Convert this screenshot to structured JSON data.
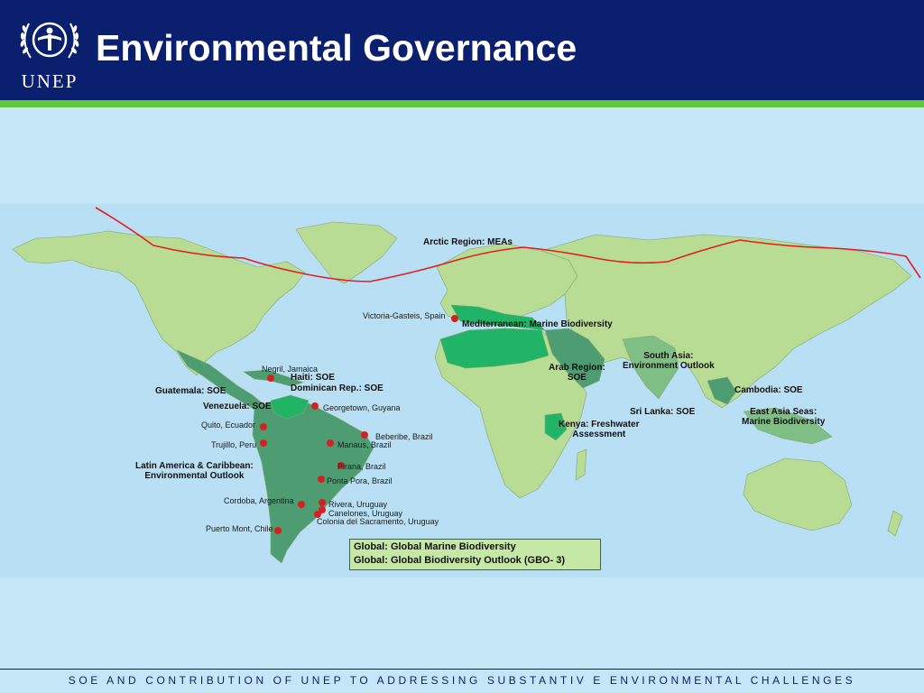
{
  "header": {
    "title": "Environmental Governance",
    "logo_text": "UNEP",
    "bg_color": "#0a1f6e",
    "accent_color": "#5ec83a"
  },
  "map": {
    "arctic_label": "Arctic Region: MEAs",
    "region_labels": {
      "mediterranean": "Mediterranean: Marine Biodiversity",
      "arab_region": [
        "Arab Region:",
        "SOE"
      ],
      "south_asia": [
        "South Asia:",
        "Environment Outlook"
      ],
      "cambodia": "Cambodia: SOE",
      "sri_lanka": "Sri Lanka: SOE",
      "east_asia_seas": [
        "East Asia Seas:",
        "Marine Biodiversity"
      ],
      "kenya": [
        "Kenya: Freshwater",
        "Assessment"
      ],
      "haiti": "Haiti: SOE",
      "dominican_rep": "Dominican Rep.: SOE",
      "guatemala": "Guatemala: SOE",
      "venezuela": "Venezuela: SOE",
      "latin_america": [
        "Latin America & Caribbean:",
        "Environmental Outlook"
      ]
    },
    "city_labels": {
      "victoria_gasteis": "Victoria-Gasteis, Spain",
      "negril": "Negril, Jamaica",
      "georgetown": "Georgetown, Guyana",
      "quito": "Quito, Ecuador",
      "trujillo": "Trujillo, Peru",
      "beberibe": "Beberibe, Brazil",
      "manaus": "Manaus, Brazil",
      "pirana": "Pirana, Brazil",
      "ponta_pora": "Ponta Pora, Brazil",
      "cordoba": "Cordoba, Argentina",
      "rivera": "Rivera, Uruguay",
      "canelones": "Canelones,  Uruguay",
      "colonia": "Colonia del Sacramento, Uruguay",
      "puerto_montt": "Puerto Mont, Chile"
    },
    "legend": {
      "line1": "Global: Global Marine Biodiversity",
      "line2": "Global: Global Biodiversity Outlook (GBO- 3)"
    },
    "colors": {
      "ocean": "#b8dff3",
      "land": "#b9dc94",
      "highlight_dark": "#4e9c72",
      "highlight_bright": "#22b466",
      "marker": "#d42020",
      "arctic_line": "#e02020"
    }
  },
  "footer": {
    "text": "SOE AND CONTRIBUTION OF UNEP TO ADDRESSING SUBSTANTIV E ENVIRONMENTAL CHALLENGES"
  }
}
